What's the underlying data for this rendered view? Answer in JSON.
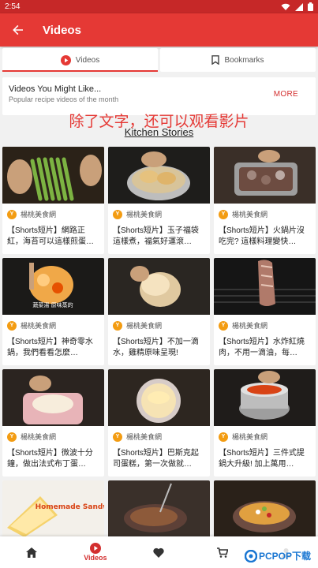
{
  "status_bar": {
    "time": "2:54"
  },
  "app_bar": {
    "title": "Videos"
  },
  "tabs": [
    {
      "label": "Videos",
      "icon": "play-circle-icon",
      "active": true
    },
    {
      "label": "Bookmarks",
      "icon": "bookmark-icon",
      "active": false
    }
  ],
  "suggest": {
    "title": "Videos You Might Like...",
    "subtitle": "Popular recipe videos of the month",
    "more": "MORE"
  },
  "overlay_caption": "除了文字，还可以观看影片",
  "section_title": "Kitchen Stories",
  "cards": [
    {
      "author": "楊桃美食網",
      "title": "【Shorts短片】網路正紅，海苔可以這樣煎蛋…",
      "thumb": "asparagus"
    },
    {
      "author": "楊桃美食網",
      "title": "【Shorts短片】玉子福袋這樣煮，福氣好運滾…",
      "thumb": "dumplings"
    },
    {
      "author": "楊桃美食網",
      "title": "【Shorts短片】火鍋片沒吃完? 這樣料理變快…",
      "thumb": "tray"
    },
    {
      "author": "楊桃美食網",
      "title": "【Shorts短片】神奇零水鍋，我們看看怎麼…",
      "thumb": "pot"
    },
    {
      "author": "楊桃美食網",
      "title": "【Shorts短片】不加一滴水，雞精原味呈現!",
      "thumb": "chicken"
    },
    {
      "author": "楊桃美食網",
      "title": "【Shorts短片】水炸紅燒肉，不用一滴油，每…",
      "thumb": "ribs"
    },
    {
      "author": "楊桃美食網",
      "title": "【Shorts短片】微波十分鐘，做出法式布丁蛋…",
      "thumb": "pudding"
    },
    {
      "author": "楊桃美食網",
      "title": "【Shorts短片】巴斯克起司蛋糕，第一次做就…",
      "thumb": "cheesecake"
    },
    {
      "author": "楊桃美食網",
      "title": "【Shorts短片】三件式提鍋大升級! 加上萬用…",
      "thumb": "steamer"
    },
    {
      "author": "",
      "title": "",
      "thumb": "sandwich"
    },
    {
      "author": "",
      "title": "",
      "thumb": "steak"
    },
    {
      "author": "",
      "title": "",
      "thumb": "rice"
    }
  ],
  "thumb_labels": {
    "pot": "蔬菜湯 原味蒸的",
    "sandwich": "Homemade Sandwich"
  },
  "bottom_nav": [
    {
      "label": "",
      "icon": "home-icon"
    },
    {
      "label": "Videos",
      "icon": "play-circle-icon",
      "active": true
    },
    {
      "label": "",
      "icon": "heart-icon"
    },
    {
      "label": "",
      "icon": "cart-icon"
    },
    {
      "label": "",
      "icon": "account-icon"
    }
  ],
  "watermark": "PCPOP下载",
  "colors": {
    "primary": "#e53935",
    "status": "#c62828",
    "accent_text": "#d32f2f",
    "logo": "#f39c12"
  }
}
